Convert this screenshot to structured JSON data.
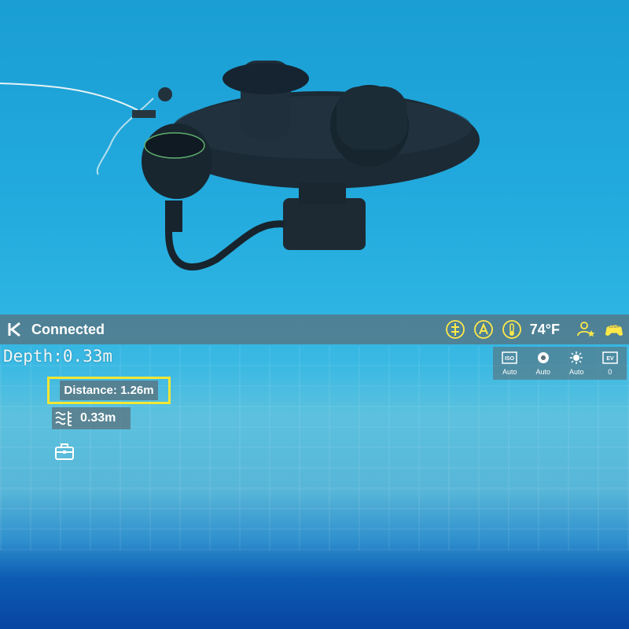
{
  "status_bar": {
    "connection": "Connected",
    "temperature": "74°F",
    "icons": [
      "logo-k-icon",
      "thruster-icon",
      "auto-mode-icon",
      "thermometer-icon",
      "user-star-icon",
      "gamepad-usa-icon"
    ],
    "gamepad_label": "USA"
  },
  "depth": {
    "label": "Depth:0.33m"
  },
  "distance": {
    "label": "Distance: 1.26m",
    "highlight_color": "#f3e634"
  },
  "altitude": {
    "value": "0.33m"
  },
  "camera_settings": [
    {
      "icon": "iso-icon",
      "badge": "ISO",
      "value": "Auto"
    },
    {
      "icon": "shutter-icon",
      "value": "Auto"
    },
    {
      "icon": "white-balance-icon",
      "value": "Auto"
    },
    {
      "icon": "ev-icon",
      "badge": "EV",
      "value": "0"
    }
  ],
  "colors": {
    "water": "#22a9dd",
    "overlay": "#5a6e78",
    "accent_yellow": "#f3e634"
  }
}
